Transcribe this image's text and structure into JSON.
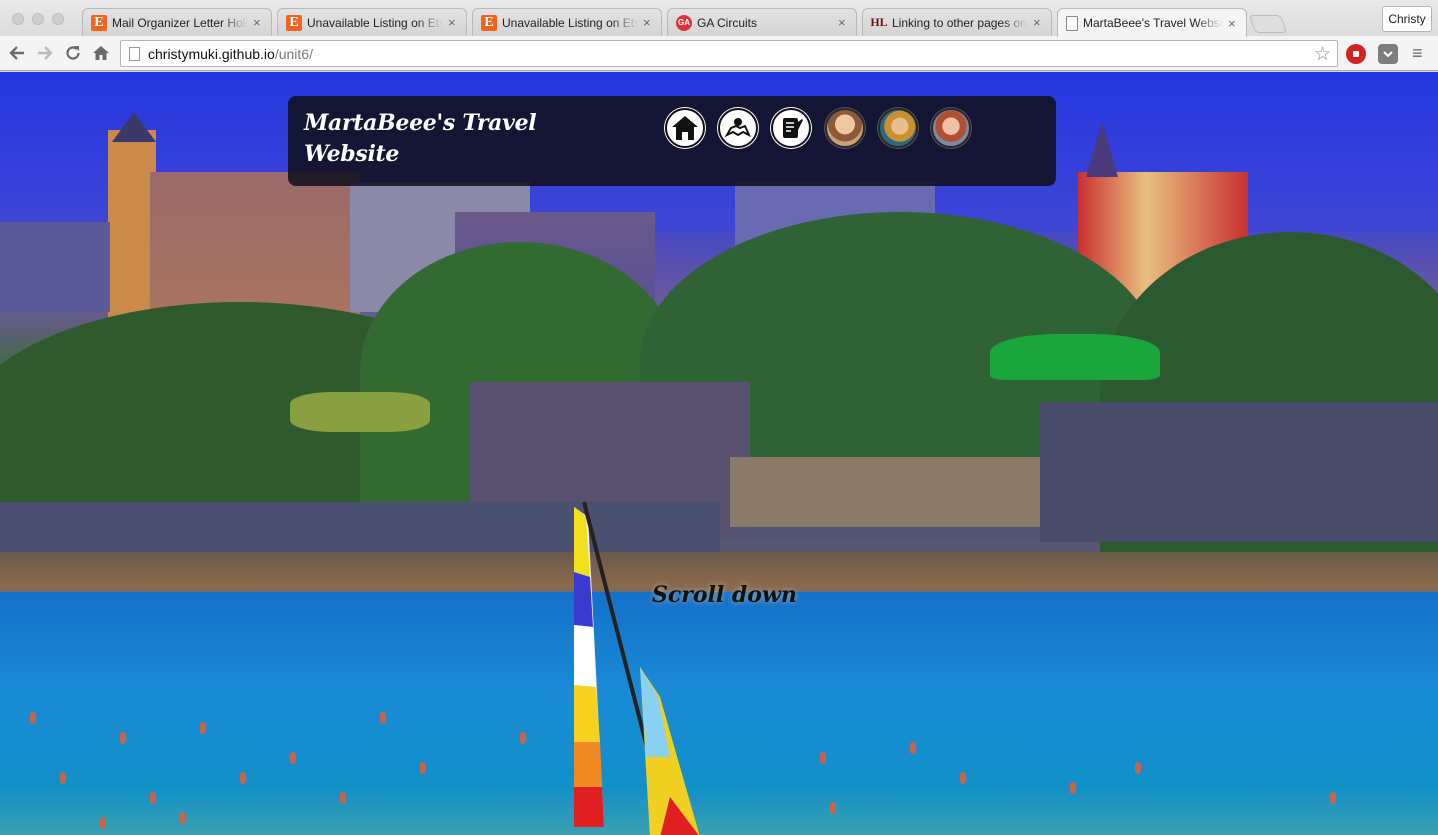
{
  "browser": {
    "tabs": [
      {
        "title": "Mail Organizer Letter Holde",
        "favicon": "etsy-icon",
        "favicon_text": "E",
        "active": false
      },
      {
        "title": "Unavailable Listing on Etsy",
        "favicon": "etsy-icon",
        "favicon_text": "E",
        "active": false
      },
      {
        "title": "Unavailable Listing on Etsy",
        "favicon": "etsy-icon",
        "favicon_text": "E",
        "active": false
      },
      {
        "title": "GA Circuits",
        "favicon": "ga-icon",
        "favicon_text": "GA",
        "active": false
      },
      {
        "title": "Linking to other pages on y",
        "favicon": "hl-icon",
        "favicon_text": "HL",
        "active": false
      },
      {
        "title": "MartaBeee's Travel Website",
        "favicon": "page-icon",
        "favicon_text": "",
        "active": true
      }
    ],
    "tab_close_glyph": "×",
    "profile_name": "Christy",
    "address": {
      "host": "christymuki.github.io",
      "path": "/unit6/"
    },
    "icons": {
      "back": "back-arrow-icon",
      "forward": "forward-arrow-icon",
      "reload": "reload-icon",
      "home": "home-icon",
      "bookmark": "star-icon",
      "extension1": "adblock-icon",
      "extension2": "pocket-icon",
      "menu": "hamburger-menu-icon"
    }
  },
  "site": {
    "title_line1": "MartaBeee's Travel",
    "title_line2": "Website",
    "nav_icons": [
      {
        "name": "home-icon"
      },
      {
        "name": "map-icon"
      },
      {
        "name": "notebook-icon"
      },
      {
        "name": "avatar-1"
      },
      {
        "name": "avatar-2"
      },
      {
        "name": "avatar-3"
      }
    ],
    "scroll_hint": "Scroll down"
  },
  "colors": {
    "panel_bg": "#10101c",
    "sky": "#2f3fd6",
    "sea": "#1a8ad6"
  }
}
